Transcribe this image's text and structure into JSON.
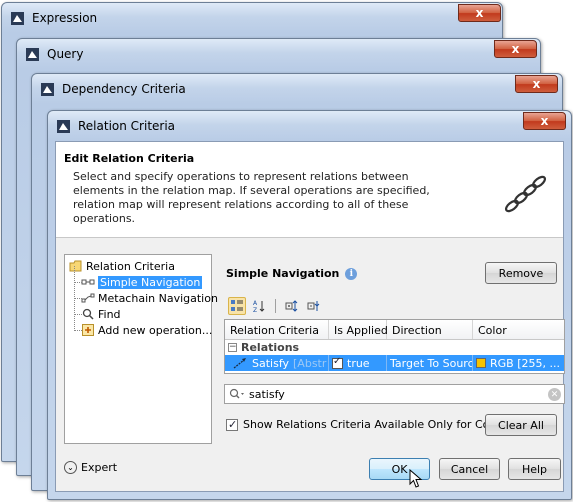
{
  "windows": {
    "expression_title": "Expression",
    "query_title": "Query",
    "dependency_title": "Dependency Criteria",
    "relation_title": "Relation Criteria",
    "close_glyph": "x"
  },
  "header": {
    "title": "Edit Relation Criteria",
    "description": "Select and specify operations to represent relations between elements in the relation map. If several operations are specified, relation map will represent relations according to all of these operations."
  },
  "tree": {
    "root": "Relation Criteria",
    "items": [
      {
        "label": "Simple Navigation",
        "selected": true,
        "icon": "navigation-icon"
      },
      {
        "label": "Metachain Navigation",
        "selected": false,
        "icon": "metachain-icon"
      },
      {
        "label": "Find",
        "selected": false,
        "icon": "find-icon"
      },
      {
        "label": "Add new operation...",
        "selected": false,
        "icon": "add-icon"
      }
    ]
  },
  "panel": {
    "title": "Simple Navigation",
    "remove_label": "Remove",
    "columns": [
      "Relation Criteria",
      "Is Applied",
      "Direction",
      "Color"
    ],
    "group": "Relations",
    "row": {
      "name": "Satisfy",
      "faded": "[Abstr",
      "applied": "true",
      "direction": "Target To Source",
      "color": "RGB [255, ..."
    },
    "search_value": "satisfy",
    "context_checkbox_label": "Show Relations Criteria Available Only for Context",
    "clear_all_label": "Clear All"
  },
  "footer": {
    "expert_label": "Expert",
    "ok_label": "OK",
    "cancel_label": "Cancel",
    "help_label": "Help"
  },
  "colors": {
    "selection": "#3399ff",
    "close_button": "#c1391c",
    "swatch": "#f5c300"
  }
}
